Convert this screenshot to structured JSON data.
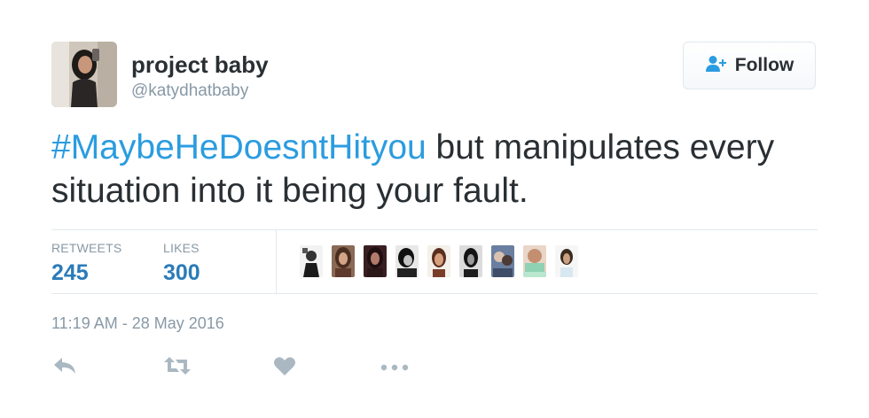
{
  "author": {
    "name": "project baby",
    "handle": "@katydhatbaby"
  },
  "follow_button": {
    "label": "Follow",
    "icon": "add-user-icon"
  },
  "tweet": {
    "hashtag": "#MaybeHeDoesntHityou",
    "text": " but manipulates every situation into it being your fault."
  },
  "stats": {
    "retweets_label": "RETWEETS",
    "retweets_value": "245",
    "likes_label": "LIKES",
    "likes_value": "300"
  },
  "likers_count_shown": 9,
  "timestamp": "11:19 AM - 28 May 2016",
  "actions": [
    "reply-icon",
    "retweet-icon",
    "heart-icon",
    "more-icon"
  ],
  "colors": {
    "accent": "#2b9ce0",
    "stat_value": "#2b7bb9",
    "text": "#292f33",
    "muted": "#8899a6",
    "border": "#e1e8ed"
  }
}
